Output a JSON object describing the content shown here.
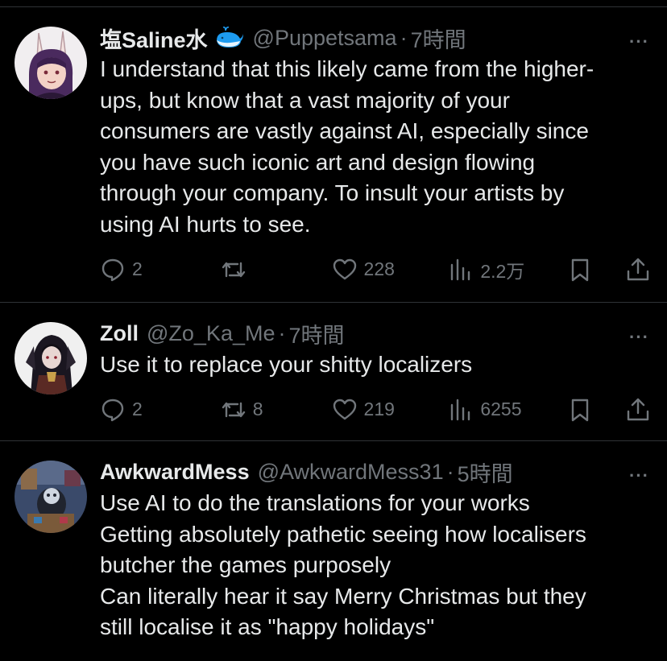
{
  "tweets": [
    {
      "name": "塩Saline水",
      "badge_icon": "whale-icon",
      "handle": "@Puppetsama",
      "sep": "·",
      "time": "7時間",
      "more_label": "···",
      "text": "I understand that this likely came from the higher-\nups, but know that a vast majority of your\nconsumers are vastly against AI, especially since\nyou have such iconic art and design flowing\nthrough your company. To insult your artists by\nusing AI hurts to see.",
      "replies": "2",
      "retweets": "",
      "likes": "228",
      "views": "2.2万"
    },
    {
      "name": "Zoll",
      "handle": "@Zo_Ka_Me",
      "sep": "·",
      "time": "7時間",
      "more_label": "···",
      "text": "Use it to replace your shitty localizers",
      "replies": "2",
      "retweets": "8",
      "likes": "219",
      "views": "6255"
    },
    {
      "name": "AwkwardMess",
      "handle": "@AwkwardMess31",
      "sep": "·",
      "time": "5時間",
      "more_label": "···",
      "text": "Use AI to do the translations for your works\nGetting absolutely pathetic seeing how localisers\nbutcher the games purposely\nCan literally hear it say Merry Christmas but they\nstill localise it as \"happy holidays\""
    }
  ],
  "colors": {
    "background": "#000000",
    "text_primary": "#e7e9ea",
    "text_secondary": "#71767b",
    "divider": "#2f3336",
    "whale_badge": "#1d9bf0"
  }
}
